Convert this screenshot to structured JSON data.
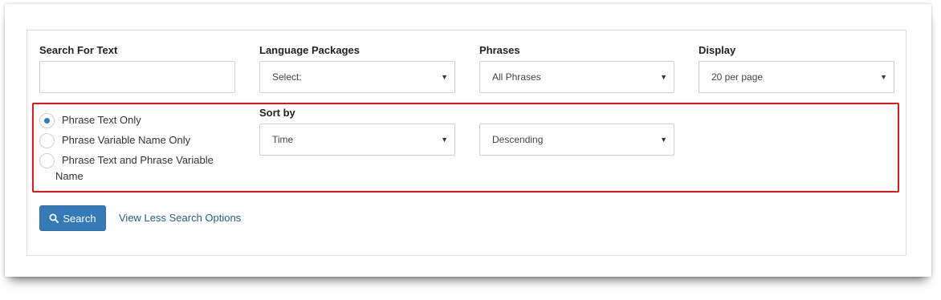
{
  "form": {
    "search_text": {
      "label": "Search For Text",
      "value": ""
    },
    "language_packages": {
      "label": "Language Packages",
      "selected": "Select:"
    },
    "phrases": {
      "label": "Phrases",
      "selected": "All Phrases"
    },
    "display": {
      "label": "Display",
      "selected": "20 per page"
    },
    "match_options": [
      {
        "label": "Phrase Text Only",
        "checked": true
      },
      {
        "label": "Phrase Variable Name Only",
        "checked": false
      },
      {
        "label": "Phrase Text and Phrase Variable",
        "label_cont": "Name",
        "checked": false
      }
    ],
    "sort_by": {
      "label": "Sort by",
      "field": "Time",
      "direction": "Descending"
    },
    "search_button": "Search",
    "toggle_link": "View Less Search Options"
  },
  "icons": {
    "search_button_icon": "search-icon",
    "dropdown_icon": "caret-down-icon"
  },
  "colors": {
    "primary": "#337ab7",
    "highlight": "#e0141e",
    "link": "#1f5f7a",
    "radio_checked": "#2a7bc0"
  }
}
